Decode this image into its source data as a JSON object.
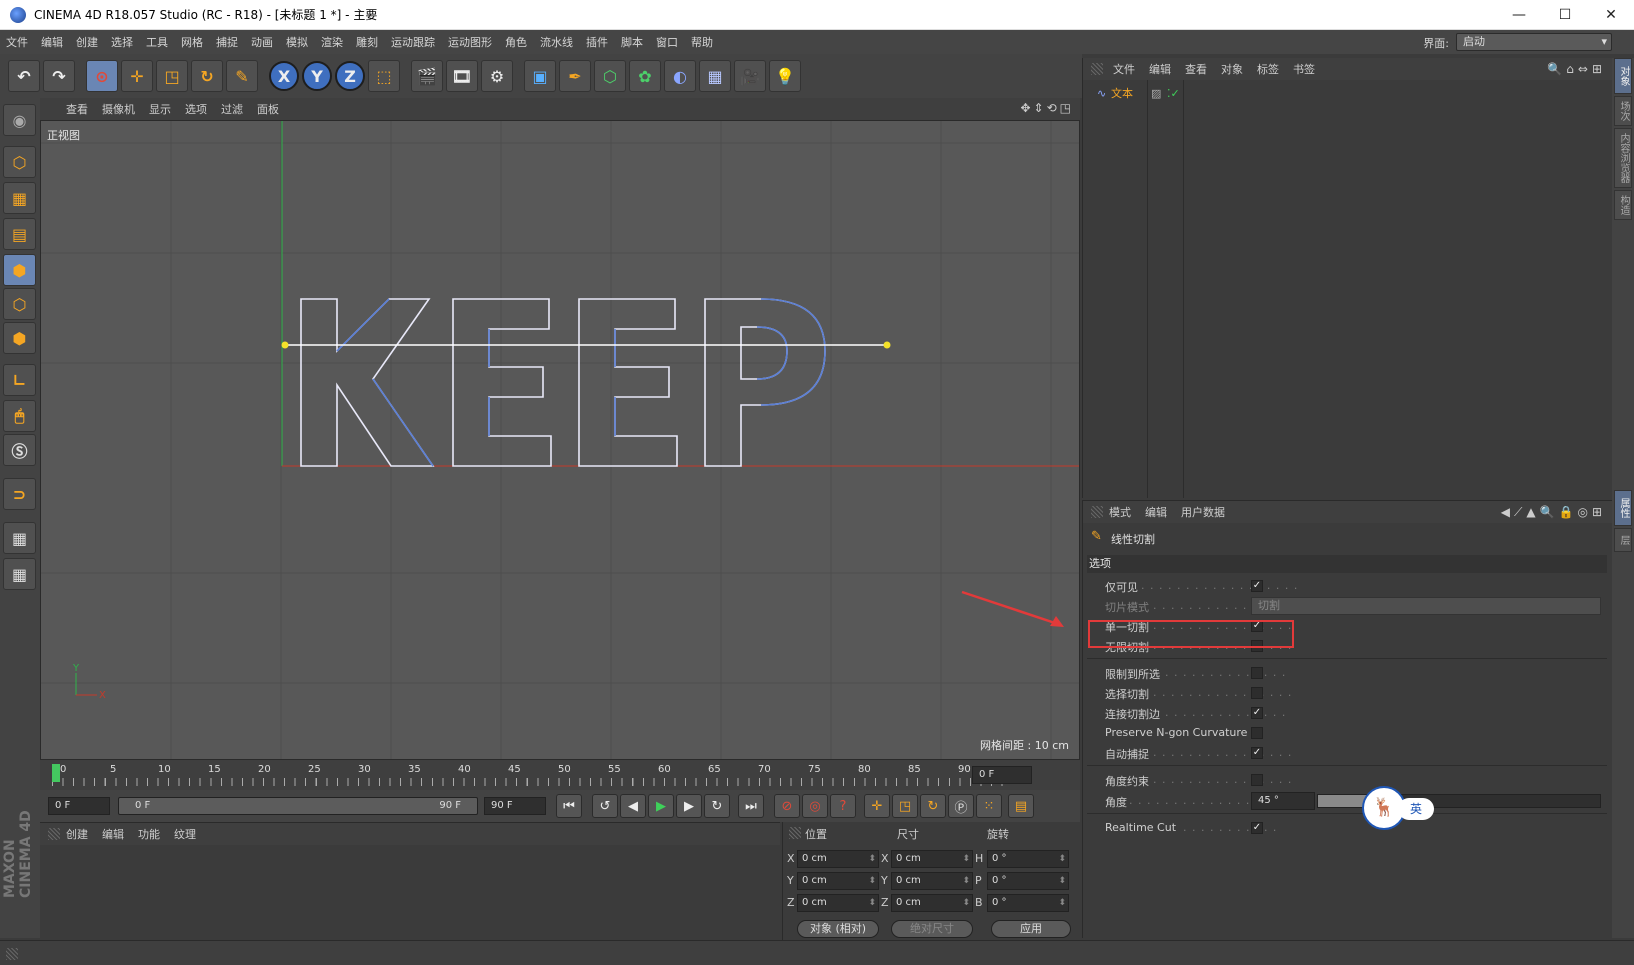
{
  "window": {
    "title": "CINEMA 4D R18.057 Studio (RC - R18) - [未标题 1 *] - 主要",
    "min_icon": "—",
    "max_icon": "☐",
    "close_icon": "✕"
  },
  "menubar": {
    "items": [
      "文件",
      "编辑",
      "创建",
      "选择",
      "工具",
      "网格",
      "捕捉",
      "动画",
      "模拟",
      "渲染",
      "雕刻",
      "运动跟踪",
      "运动图形",
      "角色",
      "流水线",
      "插件",
      "脚本",
      "窗口",
      "帮助"
    ],
    "layout_label": "界面:",
    "layout_value": "启动"
  },
  "toolbar": {
    "axis_x": "X",
    "axis_y": "Y",
    "axis_z": "Z"
  },
  "viewport": {
    "menu": [
      "查看",
      "摄像机",
      "显示",
      "选项",
      "过滤",
      "面板"
    ],
    "label": "正视图",
    "grid_spacing": "网格间距 : 10 cm",
    "text_object": "KEEP",
    "axis_y": "Y",
    "axis_x": "X"
  },
  "timeline": {
    "ticks": [
      "0",
      "5",
      "10",
      "15",
      "20",
      "25",
      "30",
      "35",
      "40",
      "45",
      "50",
      "55",
      "60",
      "65",
      "70",
      "75",
      "80",
      "85",
      "90"
    ],
    "current_frame": "0 F",
    "start_frame": "0 F",
    "range_start": "0 F",
    "range_end": "90 F",
    "end_frame": "90 F"
  },
  "material_manager": {
    "menu": [
      "创建",
      "编辑",
      "功能",
      "纹理"
    ]
  },
  "coordinates": {
    "headers": [
      "位置",
      "尺寸",
      "旋转"
    ],
    "rows": [
      {
        "axis": "X",
        "pos": "0 cm",
        "saxis": "X",
        "size": "0 cm",
        "raxis": "H",
        "rot": "0 °"
      },
      {
        "axis": "Y",
        "pos": "0 cm",
        "saxis": "Y",
        "size": "0 cm",
        "raxis": "P",
        "rot": "0 °"
      },
      {
        "axis": "Z",
        "pos": "0 cm",
        "saxis": "Z",
        "size": "0 cm",
        "raxis": "B",
        "rot": "0 °"
      }
    ],
    "mode": "对象 (相对)",
    "size_mode": "绝对尺寸",
    "apply": "应用"
  },
  "object_manager": {
    "menu": [
      "文件",
      "编辑",
      "查看",
      "对象",
      "标签",
      "书签"
    ],
    "object_name": "文本"
  },
  "right_tabs": {
    "top": [
      "对象",
      "场次",
      "内容浏览器",
      "构造"
    ],
    "bottom": [
      "属性",
      "层"
    ]
  },
  "attribute_manager": {
    "menu": [
      "模式",
      "编辑",
      "用户数据"
    ],
    "tool_name": "线性切割",
    "section": "选项",
    "rows": [
      {
        "label": "仅可见",
        "checked": "✓"
      },
      {
        "label": "切片模式",
        "value": "切割"
      },
      {
        "label": "单一切割",
        "checked": "✓"
      },
      {
        "label": "无限切割",
        "checked": ""
      },
      {
        "label": "限制到所选",
        "checked": ""
      },
      {
        "label": "选择切割",
        "checked": ""
      },
      {
        "label": "连接切割边",
        "checked": "✓"
      },
      {
        "label": "Preserve N-gon Curvature",
        "checked": ""
      },
      {
        "label": "自动捕捉",
        "checked": "✓"
      },
      {
        "label": "角度约束",
        "checked": ""
      },
      {
        "label": "角度",
        "value": "45 °"
      },
      {
        "label": "Realtime Cut",
        "checked": "✓"
      }
    ]
  },
  "ime": {
    "logo": "🦌",
    "lang": "英"
  },
  "colors": {
    "accent": "#f5a623",
    "highlight": "#e23a3a",
    "spline": "#5b7fd6",
    "axis_y": "#2fb34a",
    "axis_x": "#c43a2a"
  }
}
